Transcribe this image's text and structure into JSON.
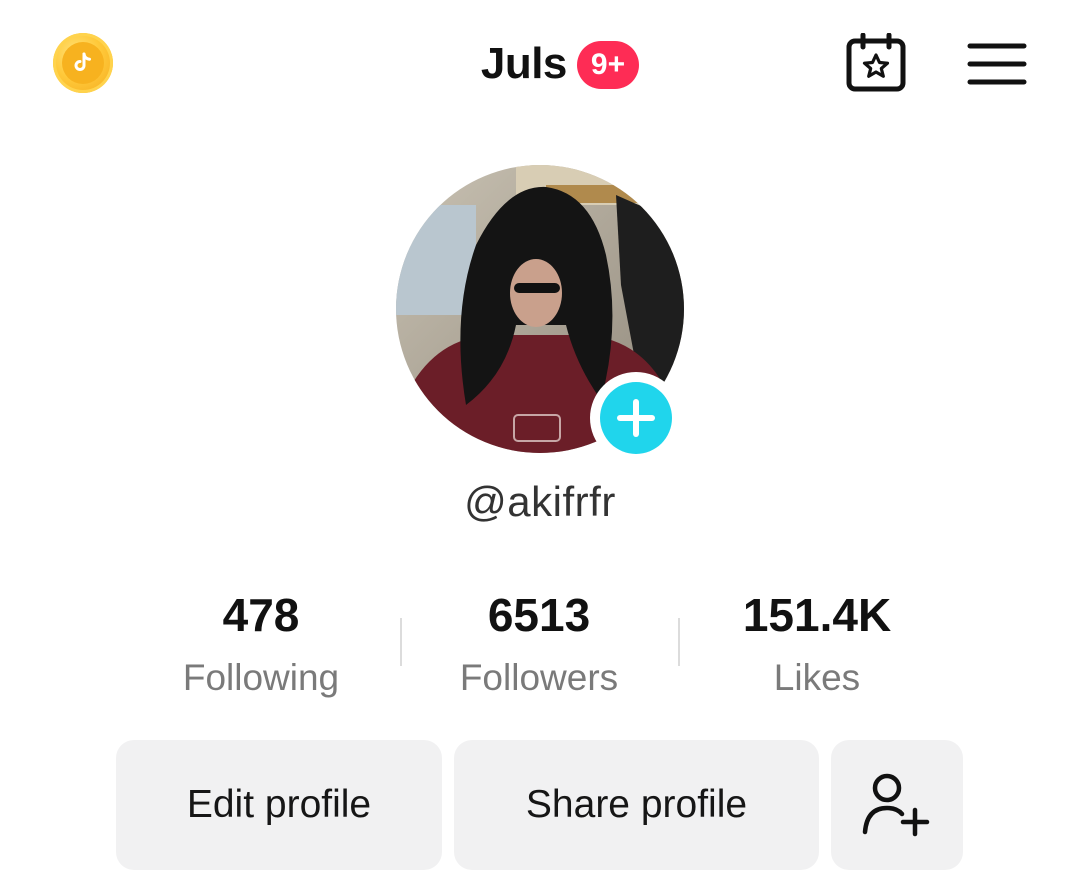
{
  "header": {
    "title": "Juls",
    "notification_badge": "9+",
    "coin_icon": "tiktok-coin-icon",
    "calendar_icon": "calendar-star-icon",
    "menu_icon": "hamburger-menu-icon"
  },
  "profile": {
    "username": "@akifrfr",
    "avatar_add_icon": "plus-icon"
  },
  "stats": [
    {
      "value": "478",
      "label": "Following"
    },
    {
      "value": "6513",
      "label": "Followers"
    },
    {
      "value": "151.4K",
      "label": "Likes"
    }
  ],
  "actions": {
    "edit_label": "Edit profile",
    "share_label": "Share profile",
    "add_friend_icon": "add-friend-icon"
  },
  "colors": {
    "badge": "#fe2c55",
    "avatar_add": "#20d5ec",
    "coin": "#f7b21f",
    "button_bg": "#f1f1f2"
  }
}
